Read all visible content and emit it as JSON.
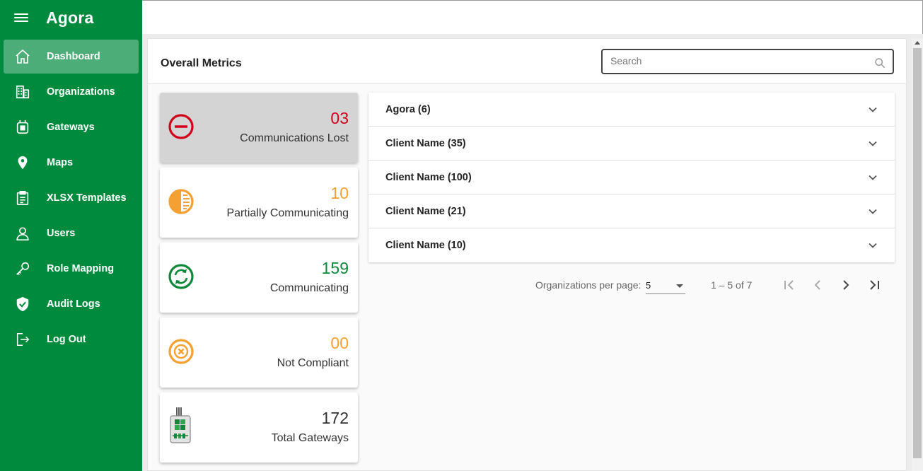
{
  "app": {
    "title": "Agora"
  },
  "sidebar": {
    "items": [
      {
        "label": "Dashboard",
        "icon": "home-icon",
        "active": true
      },
      {
        "label": "Organizations",
        "icon": "building-icon"
      },
      {
        "label": "Gateways",
        "icon": "gateway-icon"
      },
      {
        "label": "Maps",
        "icon": "map-pin-icon"
      },
      {
        "label": "XLSX Templates",
        "icon": "clipboard-icon"
      },
      {
        "label": "Users",
        "icon": "user-icon"
      },
      {
        "label": "Role Mapping",
        "icon": "key-icon"
      },
      {
        "label": "Audit Logs",
        "icon": "shield-check-icon"
      },
      {
        "label": "Log Out",
        "icon": "logout-icon"
      }
    ]
  },
  "main": {
    "title": "Overall Metrics",
    "search": {
      "placeholder": "Search",
      "value": ""
    }
  },
  "metrics": [
    {
      "value": "03",
      "label": "Communications Lost",
      "color": "#d0021b",
      "icon": "minus-circle-icon"
    },
    {
      "value": "10",
      "label": "Partially Communicating",
      "color": "#f5a033",
      "icon": "half-circle-icon"
    },
    {
      "value": "159",
      "label": "Communicating",
      "color": "#10873b",
      "icon": "sync-circle-icon"
    },
    {
      "value": "00",
      "label": "Not Compliant",
      "color": "#f5a033",
      "icon": "x-circle-icon"
    },
    {
      "value": "172",
      "label": "Total Gateways",
      "color": "#333333",
      "icon": "gateway-device-icon"
    }
  ],
  "organizations": [
    {
      "label": "Agora (6)"
    },
    {
      "label": "Client Name (35)"
    },
    {
      "label": "Client Name (100)"
    },
    {
      "label": "Client Name (21)"
    },
    {
      "label": "Client Name (10)"
    }
  ],
  "paginator": {
    "per_page_label": "Organizations per page:",
    "per_page_value": "5",
    "range": "1 – 5 of 7"
  },
  "colors": {
    "sidebar": "#008a3e",
    "active_item": "#4dad78"
  }
}
